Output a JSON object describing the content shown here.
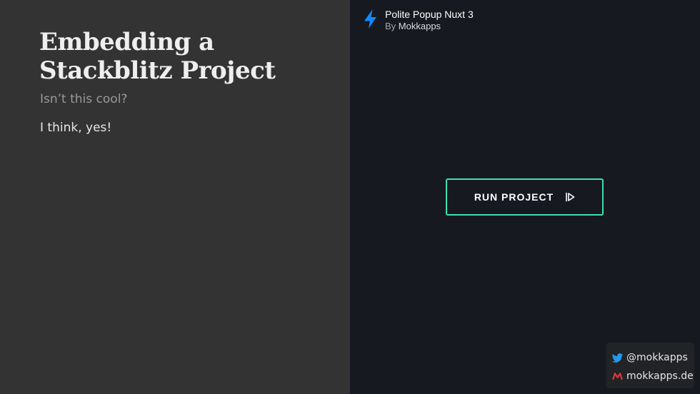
{
  "slide": {
    "title": "Embedding a Stackblitz Project",
    "subtitle": "Isn’t this cool?",
    "body": "I think, yes!"
  },
  "embed": {
    "project_title": "Polite Popup Nuxt 3",
    "byline_prefix": "By",
    "author": "Mokkapps",
    "run_button_label": "RUN PROJECT",
    "icons": {
      "logo": "stackblitz-bolt-icon",
      "run": "play-icon"
    },
    "colors": {
      "background": "#171920",
      "accent": "#3ddfb5",
      "bolt": "#1389fd"
    }
  },
  "social": {
    "twitter_handle": "@mokkapps",
    "website": "mokkapps.de",
    "icons": [
      "twitter-icon",
      "mokkapps-logo-icon"
    ],
    "colors": {
      "twitter": "#1d9bf0",
      "mokkapps": "#e0383a"
    }
  }
}
